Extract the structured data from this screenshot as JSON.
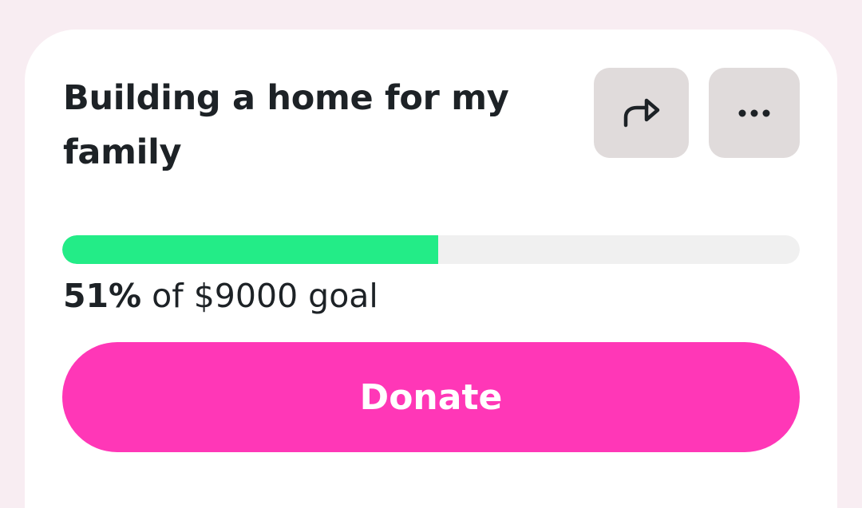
{
  "campaign": {
    "title": "Building a home for my family"
  },
  "actions": {
    "share_icon": "share-arrow-icon",
    "more_icon": "more-horizontal-icon"
  },
  "progress": {
    "percent": 51,
    "percent_label": "51%",
    "goal_label": " of $9000 goal"
  },
  "donate": {
    "label": "Donate"
  },
  "colors": {
    "page_background": "#f8edf2",
    "progress_fill": "#23ec87",
    "progress_track": "#f0f0f0",
    "donate_button": "#ff37b7",
    "icon_button": "#e0dbdb",
    "text": "#1d2226"
  }
}
